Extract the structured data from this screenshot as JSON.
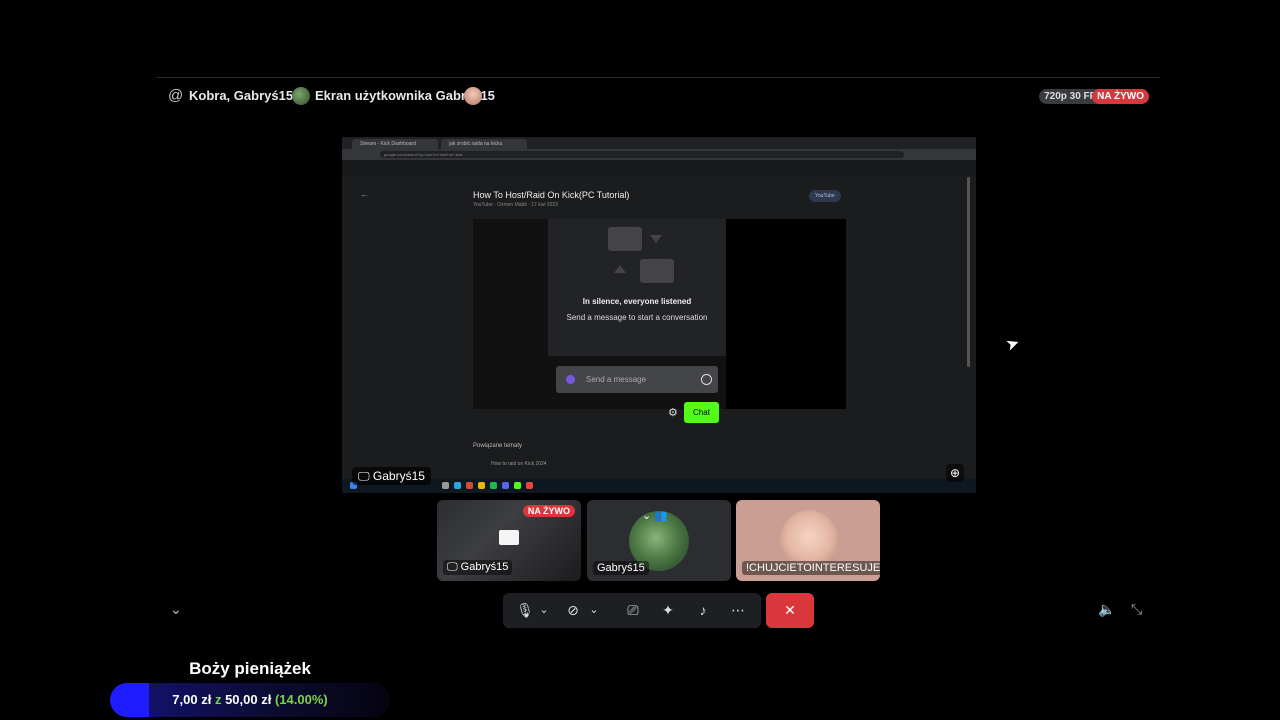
{
  "header": {
    "channel_name": "Kobra, Gabryś15",
    "screen_title": "Ekran użytkownika Gabryś15",
    "quality": "720p 30 FPS",
    "live": "NA ŻYWO"
  },
  "shared_screen": {
    "tabs": [
      "Stream - Kick Dashboard",
      "jak zrobić raida na kicku"
    ],
    "url": "google.com/search?q=how+to+raid+on+kick",
    "video_title": "How To Host/Raid On Kick(PC Tutorial)",
    "video_sub": "YouTube · Ozmen Mabit · 17 kwi 2023",
    "youtube_chip": "YouTube",
    "chat_empty_title": "In silence, everyone listened",
    "chat_empty_sub": "Send a message to start a conversation",
    "chat_placeholder": "Send a message",
    "chat_button": "Chat",
    "related_heading": "Powiązane tematy",
    "related_item": "How to raid on Kick 2024",
    "sharer": "Gabryś15"
  },
  "participants": [
    {
      "name": "Gabryś15",
      "live": "NA ŻYWO",
      "type": "screen"
    },
    {
      "name": "Gabryś15",
      "type": "avatar"
    },
    {
      "name": "!CHUJCIETOINTERESUJE",
      "type": "camera"
    }
  ],
  "icons": {
    "header": [
      "at-icon",
      "avatar",
      "avatar"
    ],
    "controls": [
      "microphone-icon",
      "chevron-down-icon",
      "camera-off-icon",
      "chevron-down-icon",
      "screen-share-icon",
      "activities-icon",
      "soundboard-icon",
      "more-icon",
      "hangup-icon"
    ],
    "right": [
      "volume-icon",
      "exit-fullscreen-icon"
    ]
  },
  "donation": {
    "title": "Boży pieniążek",
    "current": "7,00 zł",
    "separator": "z",
    "goal": "50,00 zł",
    "percent_text": "(14.00%)",
    "progress": 0.14
  },
  "colors": {
    "live_red": "#da373c",
    "chat_green": "#53fc18",
    "donation_blue": "#1f1cff",
    "percent_green": "#7bd34a"
  }
}
